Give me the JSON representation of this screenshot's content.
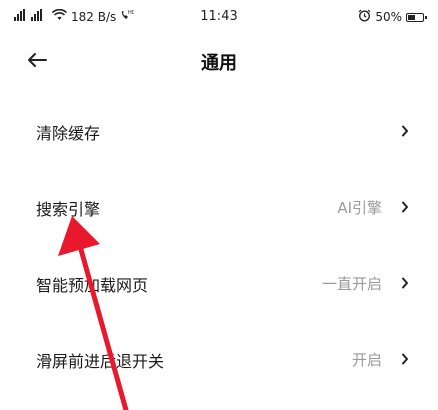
{
  "status_bar": {
    "signal": "⁴ᴳ𝗂𝗅 ²ᴳ𝗂𝗅",
    "net_speed": "182 B/s",
    "time": "11:43",
    "battery": "50%",
    "battery_level": 0.5
  },
  "header": {
    "title": "通用"
  },
  "settings": [
    {
      "label": "清除缓存",
      "value": ""
    },
    {
      "label": "搜索引擎",
      "value": "AI引擎"
    },
    {
      "label": "智能预加载网页",
      "value": "一直开启"
    },
    {
      "label": "滑屏前进后退开关",
      "value": "开启"
    }
  ],
  "colors": {
    "annotation_arrow": "#e8192c",
    "secondary_text": "#9a9a9a"
  }
}
